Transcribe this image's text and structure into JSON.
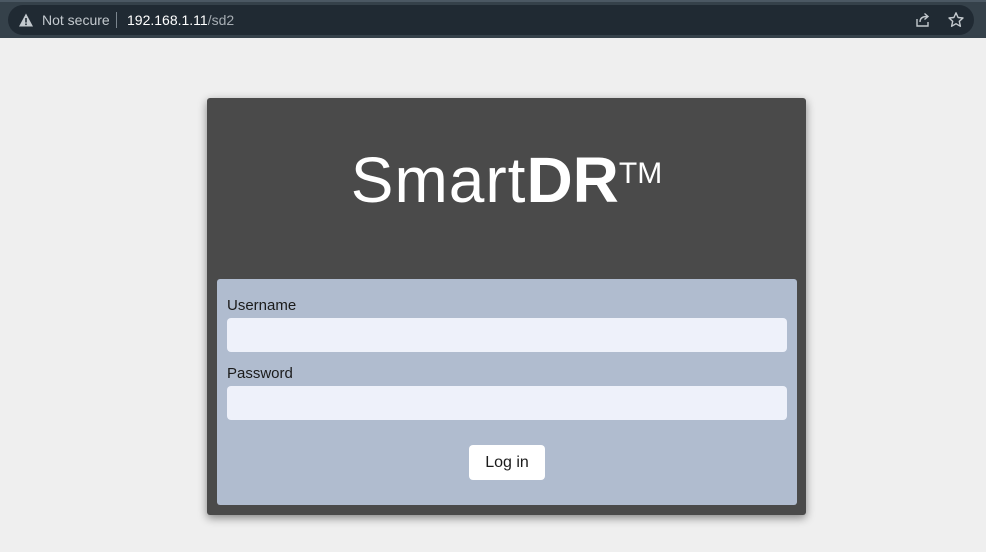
{
  "browser": {
    "security_label": "Not secure",
    "url_host": "192.168.1.11",
    "url_path": "/sd2",
    "icons": [
      "warning-icon",
      "share-icon",
      "star-icon"
    ]
  },
  "logo": {
    "thin": "Smart",
    "bold": "DR",
    "trademark": "TM"
  },
  "form": {
    "username_label": "Username",
    "username_value": "",
    "password_label": "Password",
    "password_value": "",
    "login_label": "Log in"
  },
  "colors": {
    "card": "#4a4a4a",
    "form_panel": "#b0bccf",
    "input": "#eef1fa",
    "page": "#efefef"
  }
}
